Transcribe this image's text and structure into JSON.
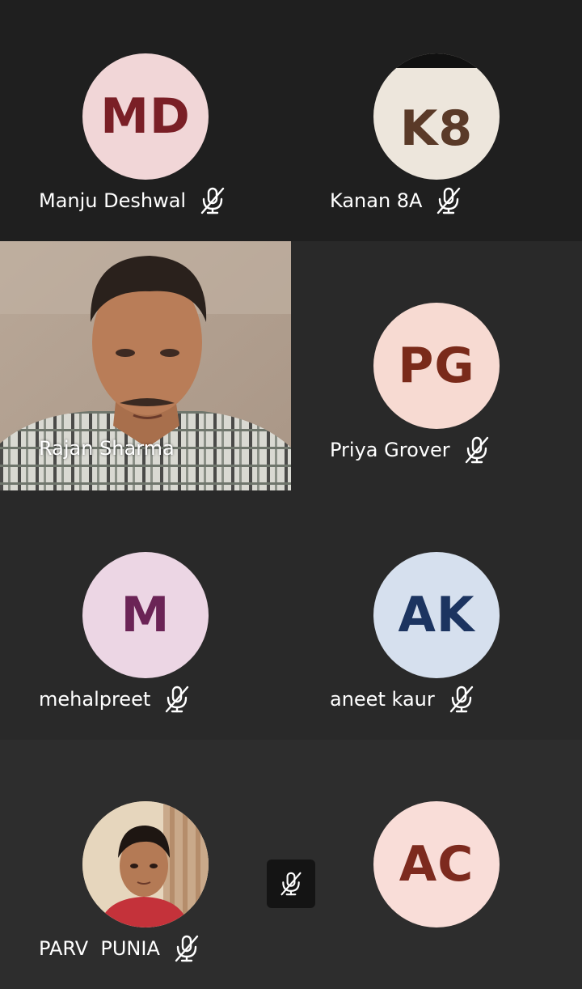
{
  "participants": [
    {
      "name": "Manju Deshwal",
      "initials": "MD",
      "muted": true,
      "avatar_bg": "#f1d6d7",
      "initials_color": "#7a1f26"
    },
    {
      "name": "Kanan 8A",
      "initials": "K8",
      "muted": true,
      "avatar_bg": "#ede6dc",
      "initials_color": "#5a3a28"
    },
    {
      "name": "Rajan Sharma",
      "initials": "",
      "muted": false,
      "video": true
    },
    {
      "name": "Priya Grover",
      "initials": "PG",
      "muted": true,
      "avatar_bg": "#f7dad2",
      "initials_color": "#7a2a1a"
    },
    {
      "name": "mehalpreet",
      "initials": "M",
      "muted": true,
      "avatar_bg": "#ecd6e4",
      "initials_color": "#6b2456"
    },
    {
      "name": "aneet kaur",
      "initials": "AK",
      "muted": true,
      "avatar_bg": "#d6e0ee",
      "initials_color": "#1c3460"
    },
    {
      "name": "PARV  PUNIA",
      "initials": "",
      "muted": true,
      "photo_avatar": true
    },
    {
      "name": "",
      "initials": "AC",
      "muted": false,
      "avatar_bg": "#f9ddd8",
      "initials_color": "#7d2a1e"
    }
  ],
  "controls": {
    "mute_icon": "mic-off-icon"
  }
}
